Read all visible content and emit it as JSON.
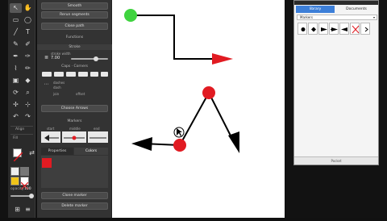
{
  "canvas": {
    "background": "#ffffff",
    "green_dot": "#3fd33f",
    "red": "#e11b22"
  },
  "tools": {
    "align_label": "Align",
    "fill_label": "Fill",
    "opacity_label": "opacity",
    "opacity_value": "100",
    "icons": [
      "select",
      "direct-select",
      "rectangle",
      "ellipse",
      "text",
      "line",
      "pen",
      "eyedropper",
      "brush",
      "path",
      "freehand",
      "pencil",
      "image",
      "rotate",
      "zoom",
      "pan",
      "undo",
      "redo"
    ]
  },
  "panel": {
    "smooth": "Smooth",
    "rerun": "Rerun segments",
    "close_path": "Close path",
    "functions_title": "Functions",
    "stroke_title": "Stroke",
    "stroke_width_label": "stroke width",
    "stroke_width_value": "7.00",
    "caps_title": "Caps · Corners",
    "dashes_label": "dashes",
    "dash_label": "dash",
    "offset_label": "offset",
    "join_label": "join",
    "divider_label": "stroke placement",
    "distance_label": "stroke factor",
    "choose_arrows": "Choose Arrows",
    "markers_title": "Markers",
    "start_label": "start",
    "middle_label": "middle",
    "end_label": "end",
    "properties_tab": "Properties",
    "colors_tab": "Colors",
    "swatch_color": "#e11b22",
    "clone_marker": "Clone marker",
    "delete_marker": "Delete marker"
  },
  "right": {
    "tab1": "library",
    "tab2": "Documents",
    "select_value": "Markers",
    "footer": "Pocket",
    "accent": "#3d7fd8",
    "markers": [
      "circle",
      "diamond",
      "flag",
      "arrow",
      "none",
      "more"
    ]
  }
}
